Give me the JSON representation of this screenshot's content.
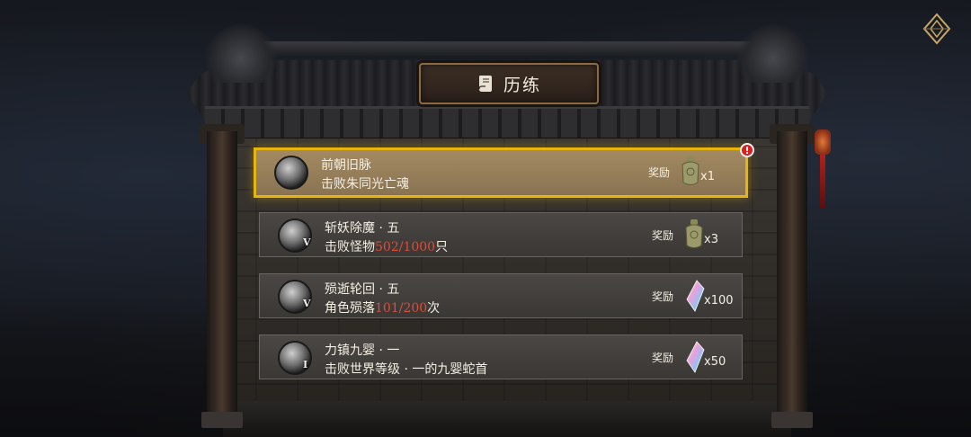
{
  "panel": {
    "title": "历练",
    "title_icon": "scroll-icon"
  },
  "menu": {
    "icon": "compass-menu-icon"
  },
  "quests": [
    {
      "name": "前朝旧脉",
      "desc_prefix": "击败朱同光亡魂",
      "progress": "",
      "desc_suffix": "",
      "tier": "",
      "reward_label": "奖励",
      "reward_icon": "jade-token-icon",
      "reward_count": "x1",
      "active": true,
      "alert": "!"
    },
    {
      "name": "斩妖除魔 · 五",
      "desc_prefix": "击败怪物",
      "progress": "502/1000",
      "desc_suffix": "只",
      "tier": "V",
      "reward_label": "奖励",
      "reward_icon": "jade-token-icon",
      "reward_count": "x3",
      "active": false,
      "alert": ""
    },
    {
      "name": "殒逝轮回 · 五",
      "desc_prefix": "角色殒落",
      "progress": "101/200",
      "desc_suffix": "次",
      "tier": "V",
      "reward_label": "奖励",
      "reward_icon": "crystal-shard-icon",
      "reward_count": "x100",
      "active": false,
      "alert": ""
    },
    {
      "name": "力镇九婴 · 一",
      "desc_prefix": "击败世界等级 · 一的九婴蛇首",
      "progress": "",
      "desc_suffix": "",
      "tier": "I",
      "reward_label": "奖励",
      "reward_icon": "crystal-shard-icon",
      "reward_count": "x50",
      "active": false,
      "alert": ""
    }
  ],
  "colors": {
    "active_border": "#e6b512",
    "progress_text": "#e04a3a",
    "alert_badge": "#d81e1e"
  }
}
